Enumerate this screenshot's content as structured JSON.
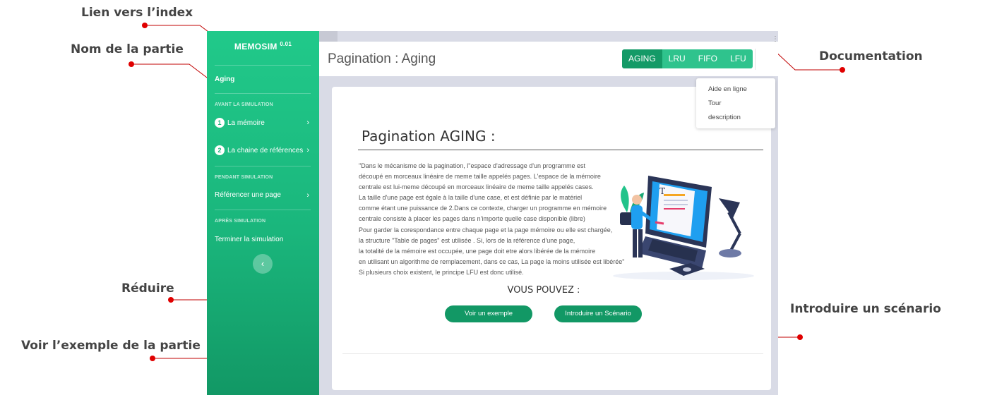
{
  "annotations": {
    "index_link": "Lien vers l’index",
    "part_name": "Nom de la partie",
    "reduce": "Réduire",
    "see_example": "Voir l’exemple de la partie",
    "documentation": "Documentation",
    "scenario": "Introduire un scénario"
  },
  "sidebar": {
    "brand": "MEMOSIM",
    "version": "0.01",
    "current": "Aging",
    "sections": [
      "AVANT LA SIMULATION",
      "PENDANT SIMULATION",
      "APRÈS SIMULATION"
    ],
    "items": [
      {
        "num": "1",
        "label": "La mémoire",
        "chevron": "›"
      },
      {
        "num": "2",
        "label": "La chaine de références",
        "chevron": "›"
      },
      {
        "label": "Référencer une page",
        "chevron": "›"
      },
      {
        "label": "Terminer la simulation"
      }
    ],
    "collapse_glyph": "‹"
  },
  "header": {
    "title": "Pagination : Aging",
    "tabs": [
      "AGING",
      "LRU",
      "FIFO",
      "LFU"
    ],
    "active_tab": "AGING",
    "menu_glyph": "⋮"
  },
  "doc_menu": {
    "items": [
      "Aide en ligne",
      "Tour",
      "description"
    ]
  },
  "content": {
    "title": "Pagination AGING :",
    "lines": [
      "\"Dans le mécanisme de la pagination, l\"espace d'adressage d'un programme est",
      "découpé en morceaux linéaire de meme taille appelés pages. L'espace de la mémoire",
      "centrale est lui-meme découpé en morceaux linéaire de meme taille appelés cases.",
      "La taille d'une page est égale à la taille d'une case, et est définie par le matériel",
      "comme étant une puissance de 2.Dans ce contexte, charger un programme en mémoire",
      "centrale consiste à placer les pages dans n'importe quelle case disponible (libre)",
      "Pour garder la corespondance entre chaque page et la page mémoire ou elle est chargée,",
      "la structure \"Table de pages\" est utilisée . Si, lors de la référence d'une page,",
      "la totalité de la mémoire est occupée, une page doit etre alors libérée de la mémoire",
      "en utilisant un algorithme de remplacement, dans ce cas, La page la moins utilisée est libérée\"",
      "Si plusieurs choix existent, le principe LFU est donc utilisé."
    ],
    "you_can": "VOUS POUVEZ :",
    "btn_example": "Voir un exemple",
    "btn_scenario": "Introduire un Scénario"
  },
  "colors": {
    "sidebar_green": "#1ab67c",
    "tab_active": "#149a67",
    "tab": "#2fc38d",
    "button": "#129865",
    "annotation_red": "#e00000"
  }
}
